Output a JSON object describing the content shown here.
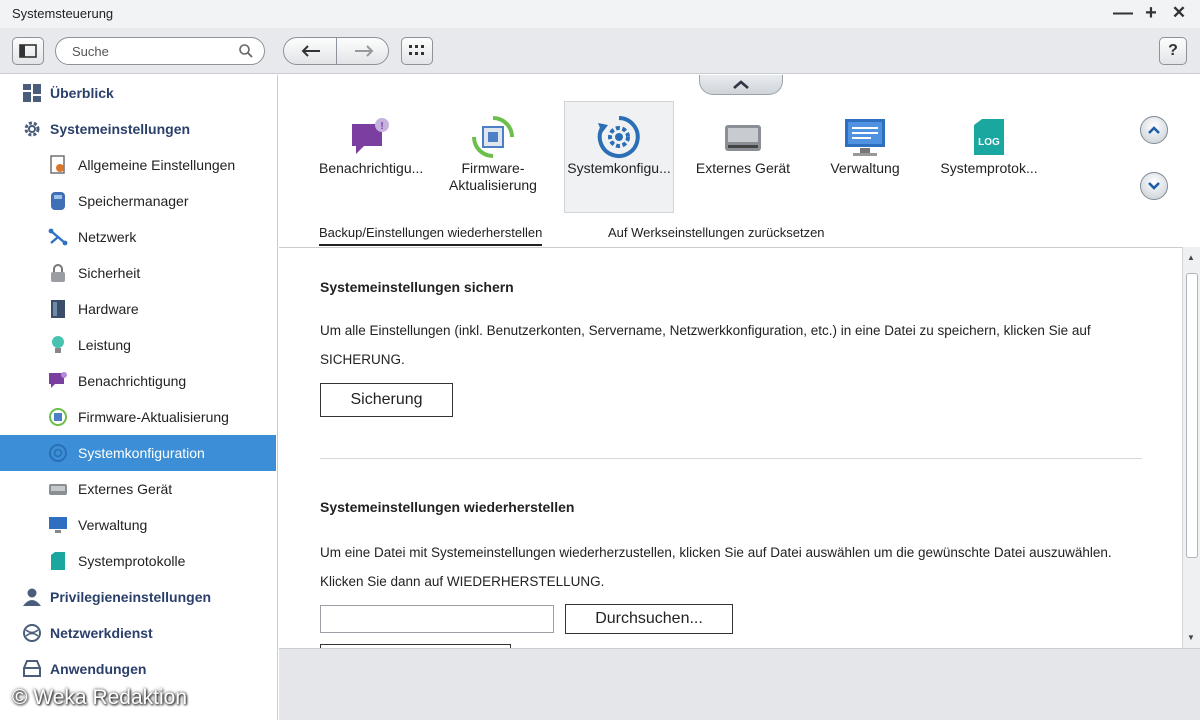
{
  "window": {
    "title": "Systemsteuerung",
    "controls": [
      "—",
      "+",
      "✕"
    ]
  },
  "toolbar": {
    "search_placeholder": "Suche",
    "help_label": "?"
  },
  "sidebar": {
    "items": [
      {
        "label": "Überblick",
        "level": "top",
        "icon": "overview-icon",
        "selected": false
      },
      {
        "label": "Systemeinstellungen",
        "level": "top",
        "icon": "gear-icon",
        "selected": false
      },
      {
        "label": "Allgemeine Einstellungen",
        "level": "sub",
        "icon": "settings-doc-icon",
        "selected": false
      },
      {
        "label": "Speichermanager",
        "level": "sub",
        "icon": "storage-icon",
        "selected": false
      },
      {
        "label": "Netzwerk",
        "level": "sub",
        "icon": "network-icon",
        "selected": false
      },
      {
        "label": "Sicherheit",
        "level": "sub",
        "icon": "lock-icon",
        "selected": false
      },
      {
        "label": "Hardware",
        "level": "sub",
        "icon": "hardware-icon",
        "selected": false
      },
      {
        "label": "Leistung",
        "level": "sub",
        "icon": "lightbulb-icon",
        "selected": false
      },
      {
        "label": "Benachrichtigung",
        "level": "sub",
        "icon": "notification-icon",
        "selected": false
      },
      {
        "label": "Firmware-Aktualisierung",
        "level": "sub",
        "icon": "firmware-icon",
        "selected": false
      },
      {
        "label": "Systemkonfiguration",
        "level": "sub",
        "icon": "sysconfig-icon",
        "selected": true
      },
      {
        "label": "Externes Gerät",
        "level": "sub",
        "icon": "external-drive-icon",
        "selected": false
      },
      {
        "label": "Verwaltung",
        "level": "sub",
        "icon": "monitor-icon",
        "selected": false
      },
      {
        "label": "Systemprotokolle",
        "level": "sub",
        "icon": "log-icon",
        "selected": false
      },
      {
        "label": "Privilegieneinstellungen",
        "level": "top",
        "icon": "user-icon",
        "selected": false
      },
      {
        "label": "Netzwerkdienst",
        "level": "top",
        "icon": "globe-icon",
        "selected": false
      },
      {
        "label": "Anwendungen",
        "level": "top",
        "icon": "applications-icon",
        "selected": false
      }
    ]
  },
  "apps": [
    {
      "label": "Benachrichtigu...",
      "icon": "notification-app-icon",
      "active": false
    },
    {
      "label": "Firmware-Aktualisierung",
      "label_line1": "Firmware-",
      "label_line2": "Aktualisierung",
      "icon": "firmware-app-icon",
      "active": false
    },
    {
      "label": "Systemkonfigu...",
      "icon": "sysconfig-app-icon",
      "active": true
    },
    {
      "label": "Externes Gerät",
      "icon": "external-drive-app-icon",
      "active": false
    },
    {
      "label": "Verwaltung",
      "icon": "monitor-app-icon",
      "active": false
    },
    {
      "label": "Systemprotok...",
      "icon": "log-app-icon",
      "active": false
    }
  ],
  "log_icon_text": "LOG",
  "tabs": [
    {
      "label": "Backup/Einstellungen wiederherstellen",
      "active": true
    },
    {
      "label": "Auf Werkseinstellungen zurücksetzen",
      "active": false
    }
  ],
  "backup": {
    "heading": "Systemeinstellungen sichern",
    "text": "Um alle Einstellungen (inkl. Benutzerkonten, Servername, Netzwerkkonfiguration, etc.) in eine Datei zu speichern, klicken Sie auf SICHERUNG.",
    "button": "Sicherung"
  },
  "restore": {
    "heading": "Systemeinstellungen wiederherstellen",
    "text": "Um eine Datei mit Systemeinstellungen wiederherzustellen, klicken Sie auf Datei auswählen um die gewünschte Datei auszuwählen. Klicken Sie dann auf WIEDERHERSTELLUNG.",
    "file_value": "",
    "browse_button": "Durchsuchen..."
  },
  "watermark": "© Weka Redaktion",
  "colors": {
    "selection": "#3c8fd6",
    "nav_text": "#2a3f6a",
    "accent_purple": "#7a3fa0",
    "accent_teal": "#1aa7a0"
  }
}
